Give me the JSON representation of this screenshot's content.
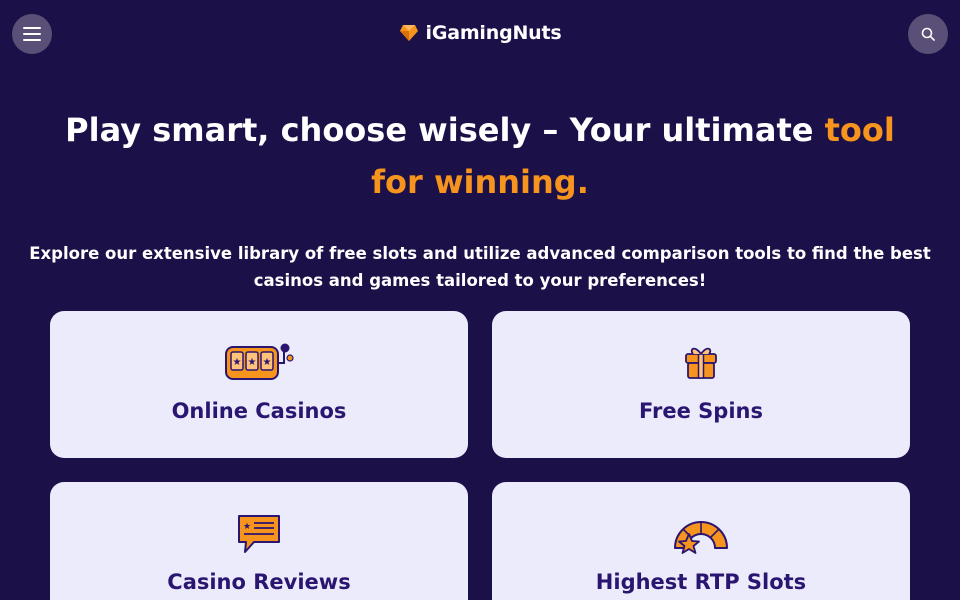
{
  "header": {
    "brand": "iGamingNuts",
    "menu_icon": "hamburger-icon",
    "search_icon": "search-icon",
    "logo_icon": "heart-gem-icon"
  },
  "hero": {
    "headline_main": "Play smart, choose wisely – Your ultimate ",
    "headline_accent": "tool for winning.",
    "subtitle": "Explore our extensive library of free slots and utilize advanced comparison tools to find the best casinos and games tailored to your preferences!"
  },
  "cards": [
    {
      "label": "Online Casinos",
      "icon": "slot-machine-icon"
    },
    {
      "label": "Free Spins",
      "icon": "gift-icon"
    },
    {
      "label": "Casino Reviews",
      "icon": "review-chat-icon"
    },
    {
      "label": "Highest RTP Slots",
      "icon": "gauge-star-icon"
    }
  ],
  "colors": {
    "background": "#1c1049",
    "accent": "#f7941d",
    "card": "#ecebfb",
    "card_text": "#2a1570",
    "header_button": "#5a5077"
  }
}
